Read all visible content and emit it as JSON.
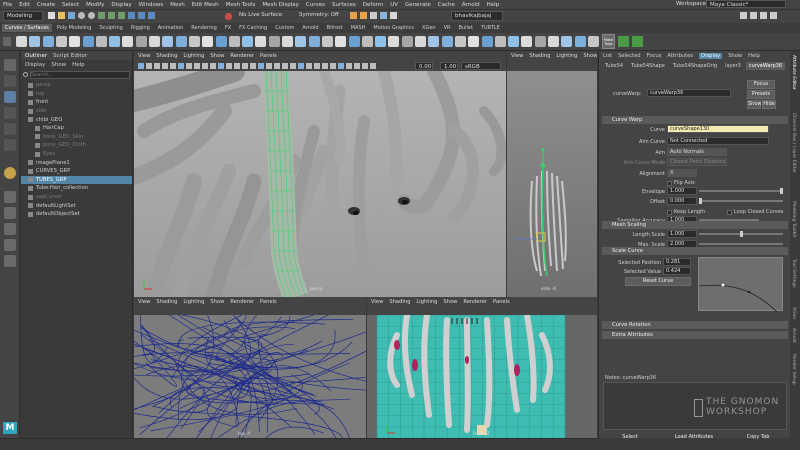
{
  "menubar": {
    "items": [
      "File",
      "Edit",
      "Create",
      "Select",
      "Modify",
      "Display",
      "Windows",
      "Mesh",
      "Edit Mesh",
      "Mesh Tools",
      "Mesh Display",
      "Curves",
      "Surfaces",
      "Deform",
      "UV",
      "Generate",
      "Cache",
      "Arnold",
      "Help"
    ],
    "workspace_label": "Workspace :",
    "workspace_value": "Maya Classic*"
  },
  "statusline": {
    "mode": "Modeling",
    "live_surface": "No Live Surface",
    "symmetry": "Symmetry: Off",
    "user": "bhavikajbajaj"
  },
  "shelf": {
    "tabs": [
      "Curves / Surfaces",
      "Poly Modeling",
      "Sculpting",
      "Rigging",
      "Animation",
      "Rendering",
      "FX",
      "FX Caching",
      "Custom",
      "Arnold",
      "Bifrost",
      "MASH",
      "Motion Graphics",
      "XGen",
      "VR",
      "Bullet",
      "TURTLE"
    ],
    "active_tab": 0,
    "make_tube_label": "Make Tube"
  },
  "outliner": {
    "tabs": [
      "Outliner",
      "Script Editor"
    ],
    "menu": [
      "Display",
      "Show",
      "Help"
    ],
    "search_placeholder": "Search...",
    "items": [
      {
        "label": "persp",
        "dim": true,
        "indent": 1
      },
      {
        "label": "top",
        "dim": true,
        "indent": 1
      },
      {
        "label": "front",
        "dim": false,
        "indent": 1
      },
      {
        "label": "side",
        "dim": true,
        "indent": 1
      },
      {
        "label": "chibi_GEO",
        "dim": false,
        "indent": 1
      },
      {
        "label": "HairCap",
        "dim": false,
        "indent": 2
      },
      {
        "label": "body_GEO_Skin",
        "dim": true,
        "indent": 2
      },
      {
        "label": "pony_GEO_Cloth",
        "dim": true,
        "indent": 2
      },
      {
        "label": "Eyes",
        "dim": true,
        "indent": 2
      },
      {
        "label": "imagePlane1",
        "dim": false,
        "indent": 1
      },
      {
        "label": "CURVES_GRP",
        "dim": false,
        "indent": 1
      },
      {
        "label": "TUBES_GRP",
        "dim": false,
        "indent": 1,
        "selected": true
      },
      {
        "label": "Tube:Hair_collection",
        "dim": false,
        "indent": 1
      },
      {
        "label": "sapCursor",
        "dim": true,
        "indent": 1
      },
      {
        "label": "defaultLightSet",
        "dim": false,
        "indent": 1
      },
      {
        "label": "defaultObjectSet",
        "dim": false,
        "indent": 1
      }
    ]
  },
  "viewports": {
    "menu": [
      "View",
      "Shading",
      "Lighting",
      "Show",
      "Renderer",
      "Panels"
    ],
    "menu_short": [
      "View",
      "Shading",
      "Lighting",
      "Show",
      "Panels"
    ],
    "persp_label": "persp",
    "side_label": "side -X",
    "top_label": "top -Y",
    "front_label": "front -Z",
    "gamma": "sRGB gamma",
    "val1": "0.00",
    "val2": "1.00"
  },
  "attribute_editor": {
    "tabs": [
      "Tube54",
      "Tube54Shape",
      "Tube54ShapeOrig",
      "layer3",
      "curveWarp36"
    ],
    "active_tab": 4,
    "menu": [
      "List",
      "Selected",
      "Focus",
      "Attributes",
      "Display",
      "Show",
      "Help"
    ],
    "node_label": "curveWarp:",
    "node_value": "curveWarp36",
    "focus_btn": "Focus",
    "presets_btn": "Presets",
    "show_btn": "Show",
    "hide_btn": "Hide",
    "sections": {
      "curve_warp": "Curve Warp",
      "mesh_scaling": "Mesh Scaling",
      "scale_curve": "Scale Curve",
      "curve_rotation": "Curve Rotation",
      "extra": "Extra Attributes"
    },
    "fields": {
      "curve_label": "Curve",
      "curve_value": "curveShape130",
      "aim_curve_label": "Aim Curve",
      "aim_curve_value": "Not Connected",
      "aim_label": "Aim",
      "aim_value": "Auto Normals",
      "aim_mode_label": "Aim Curve Mode",
      "aim_mode_value": "Closest Point Distance",
      "alignment_label": "Alignment",
      "alignment_value": "X",
      "flip_axis": "Flip Axis",
      "envelope_label": "Envelope",
      "envelope_value": "1.000",
      "offset_label": "Offset",
      "offset_value": "0.000",
      "keep_length": "Keep Length",
      "loop_closed": "Loop Closed Curves",
      "sampling_label": "Sampling Accuracy",
      "sampling_value": "1.000",
      "length_scale_label": "Length Scale",
      "length_scale_value": "1.000",
      "max_scale_label": "Max. Scale",
      "max_scale_value": "2.000",
      "sel_pos_label": "Selected Position",
      "sel_pos_value": "0.281",
      "sel_val_label": "Selected Value",
      "sel_val_value": "0.424",
      "reset_curve": "Reset Curve"
    },
    "notes_label": "Notes: curveWarp36",
    "bottom_buttons": [
      "Select",
      "Load Attributes",
      "Copy Tab"
    ]
  },
  "side_tabs": [
    "Attribute Editor",
    "Channel Box / Layer Editor",
    "Modeling Toolkit",
    "Tool Settings",
    "XGen",
    "Arnold",
    "Render Setup"
  ],
  "watermark": {
    "line1": "THE GNOMON",
    "line2": "WORKSHOP"
  },
  "colors": {
    "selection_blue": "#5285a6",
    "curve_field_yellow": "#f3eab0",
    "viewport_grey": "#a9a9a9",
    "front_teal": "#3fbdb3"
  }
}
